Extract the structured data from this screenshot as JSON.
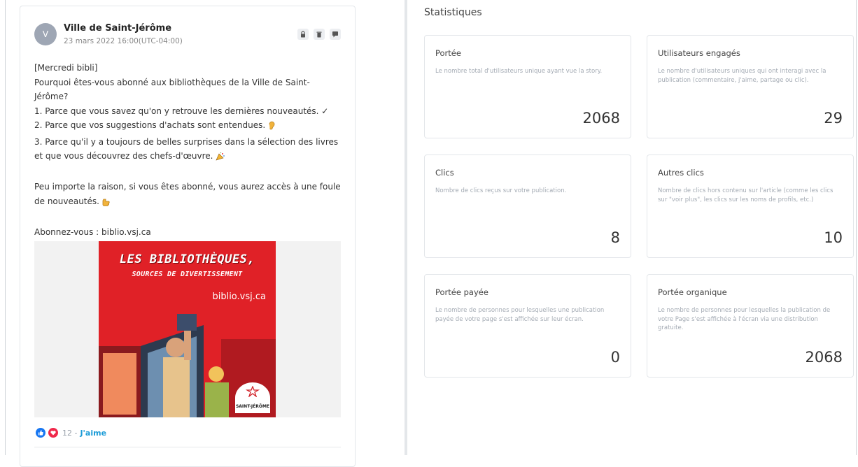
{
  "post": {
    "avatar_letter": "V",
    "author": "Ville de Saint-Jérôme",
    "date": "23 mars 2022 16:00(UTC-04:00)",
    "body": {
      "line1": "[Mercredi bibli]",
      "line2": "Pourquoi êtes-vous abonné aux bibliothèques de la Ville de Saint-Jérôme?",
      "line3": "1. Parce que vous savez qu'on y retrouve les dernières nouveautés. ✓",
      "line4": "2. Parce que vos suggestions d'achats sont entendues.",
      "line5": "3. Parce qu'il y a toujours de belles surprises dans la sélection des livres et que vous découvrez des chefs-d'œuvre.",
      "line6": "Peu importe la raison, si vous êtes abonné, vous aurez accès à une foule de nouveautés.",
      "line7": "Abonnez-vous : biblio.vsj.ca"
    },
    "poster": {
      "title": "LES BIBLIOTHÈQUES,",
      "subtitle": "SOURCES DE DIVERTISSEMENT",
      "url": "biblio.vsj.ca",
      "logo_text": "SAINT-JÉRÔME"
    },
    "reactions": {
      "count": "12 -",
      "like_label": "J'aime"
    }
  },
  "stats": {
    "title": "Statistiques",
    "cards": [
      {
        "title": "Portée",
        "desc": "Le nombre total d'utilisateurs unique ayant vue la story.",
        "value": "2068"
      },
      {
        "title": "Utilisateurs engagés",
        "desc": "Le nombre d'utilisateurs uniques qui ont interagi avec la publication (commentaire, j'aime, partage ou clic).",
        "value": "29"
      },
      {
        "title": "Clics",
        "desc": "Nombre de clics reçus sur votre publication.",
        "value": "8"
      },
      {
        "title": "Autres clics",
        "desc": "Nombre de clics hors contenu sur l'article (comme les clics sur \"voir plus\", les clics sur les noms de profils, etc.)",
        "value": "10"
      },
      {
        "title": "Portée payée",
        "desc": "Le nombre de personnes pour lesquelles une publication payée de votre page s'est affichée sur leur écran.",
        "value": "0"
      },
      {
        "title": "Portée organique",
        "desc": "Le nombre de personnes pour lesquelles la publication de votre Page s'est affichée à l'écran via une distribution gratuite.",
        "value": "2068"
      }
    ]
  },
  "icons": [
    "lock-icon",
    "trash-icon",
    "comment-icon",
    "like-reaction-icon",
    "love-reaction-icon"
  ],
  "colors": {
    "accent": "#1a9bd7",
    "poster_red": "#e02127",
    "avatar": "#9ea6b4"
  }
}
